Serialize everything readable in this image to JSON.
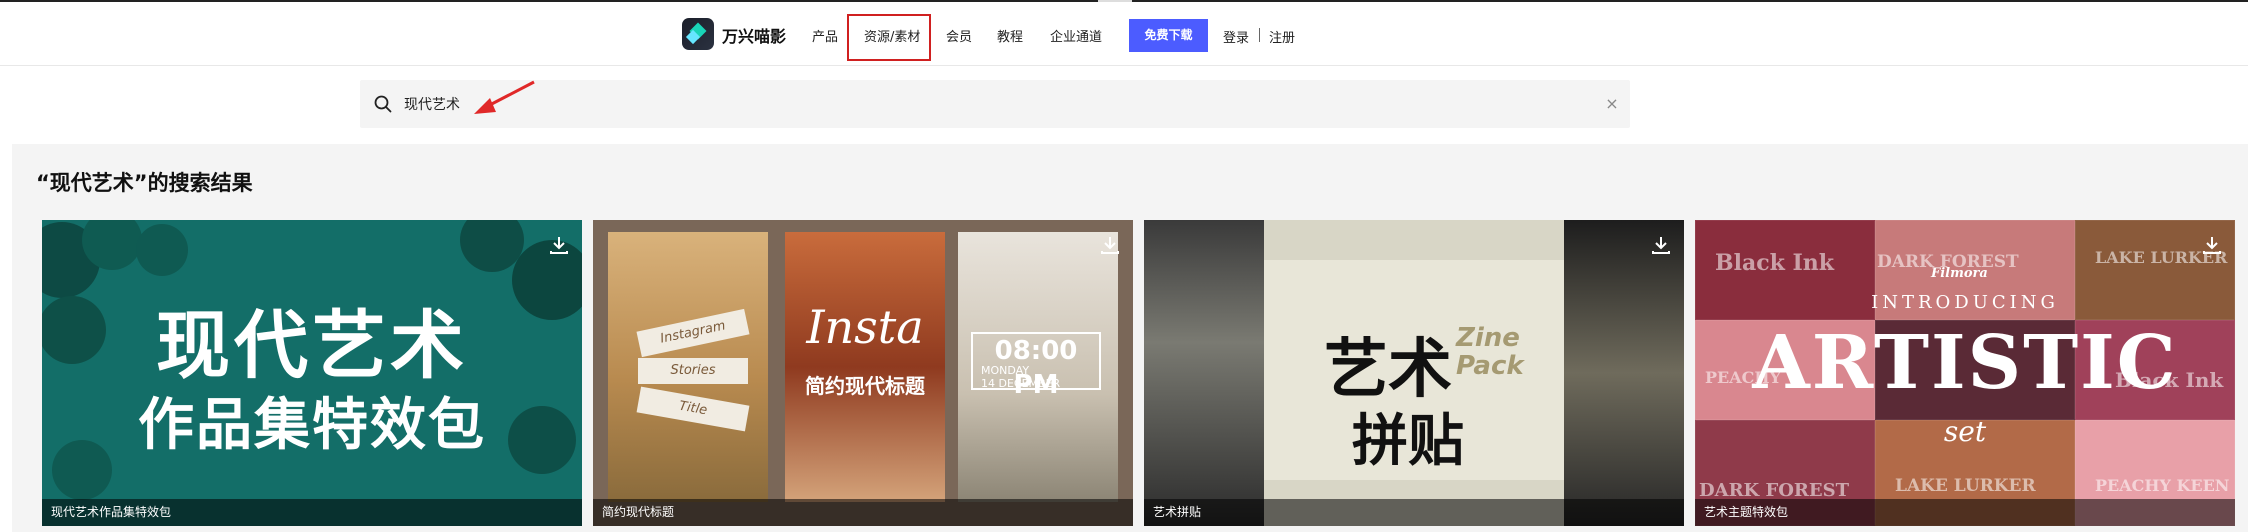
{
  "header": {
    "brand": "万兴喵影",
    "nav": [
      {
        "label": "产品"
      },
      {
        "label": "资源/素材"
      },
      {
        "label": "会员"
      },
      {
        "label": "教程"
      },
      {
        "label": "企业通道"
      }
    ],
    "download_label": "免费下载",
    "login_label": "登录",
    "register_label": "注册"
  },
  "search": {
    "value": "现代艺术"
  },
  "results": {
    "title": "“现代艺术”的搜索结果",
    "cards": [
      {
        "caption": "现代艺术作品集特效包",
        "art_line1": "现代艺术",
        "art_line2": "作品集特效包"
      },
      {
        "caption": "简约现代标题",
        "art_ribbon1": "Instagram",
        "art_ribbon2": "Stories",
        "art_ribbon3": "Title",
        "art_title": "Insta",
        "art_subtitle": "简约现代标题",
        "art_time": "08:00 PM",
        "art_date1": "MONDAY",
        "art_date2": "14 DECEMBER"
      },
      {
        "caption": "艺术拼贴",
        "art_line1": "艺术",
        "art_line2": "拼贴",
        "art_tag1": "Zine",
        "art_tag2": "Pack"
      },
      {
        "caption": "艺术主题特效包",
        "art_intro": "INTRODUCING",
        "art_main": "ARTISTIC",
        "art_set": "set",
        "art_brand": "Filmora",
        "art_tiles": [
          "Black Ink",
          "DARK FOREST",
          "LAKE LURKER",
          "PEACHY",
          "Black Ink",
          "DARK FOREST",
          "LAKE LURKER",
          "PEACHY KEEN"
        ]
      }
    ]
  },
  "colors": {
    "accent": "#4c5cff",
    "highlight": "#d02020"
  }
}
